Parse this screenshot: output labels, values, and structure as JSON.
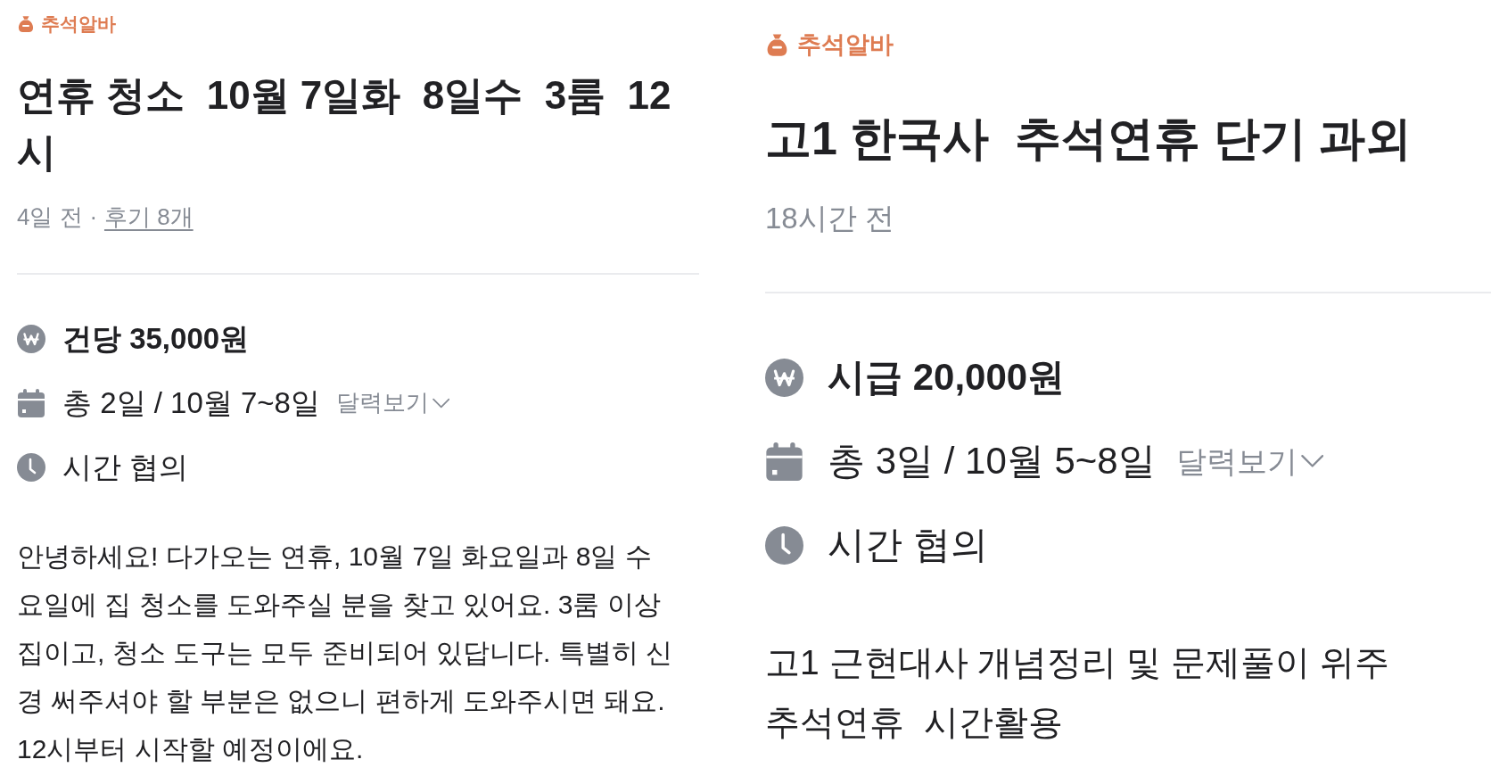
{
  "posts": [
    {
      "category": "추석알바",
      "title": "연휴 청소  10월 7일화  8일수  3룸  12시",
      "meta": [
        {
          "kind": "text",
          "text": "4일 전"
        },
        {
          "kind": "separator",
          "text": "·"
        },
        {
          "kind": "link",
          "text": "후기 8개"
        }
      ],
      "details": [
        {
          "kind": "pay",
          "text": "건당 35,000원"
        },
        {
          "kind": "date",
          "text": "총 2일 / 10월 7~8일",
          "link": "달력보기"
        },
        {
          "kind": "time",
          "text": "시간 협의"
        }
      ],
      "description": [
        "안녕하세요! 다가오는 연휴, 10월 7일 화요일과 8일 수요일에 집 청소를 도와주실 분을 찾고 있어요. 3룸 이상 집이고, 청소 도구는 모두 준비되어 있답니다. 특별히 신경 써주셔야 할 부분은 없으니 편하게 도와주시면 돼요. 12시부터 시작할 예정이에요."
      ]
    },
    {
      "category": "추석알바",
      "title": "고1 한국사  추석연휴 단기 과외",
      "meta": [
        {
          "kind": "text",
          "text": "18시간 전"
        }
      ],
      "details": [
        {
          "kind": "pay",
          "text": "시급 20,000원"
        },
        {
          "kind": "date",
          "text": "총 3일 / 10월 5~8일",
          "link": "달력보기"
        },
        {
          "kind": "time",
          "text": "시간 협의"
        }
      ],
      "description": [
        "고1 근현대사 개념정리 및 문제풀이 위주",
        "추석연휴  시간활용"
      ]
    }
  ]
}
